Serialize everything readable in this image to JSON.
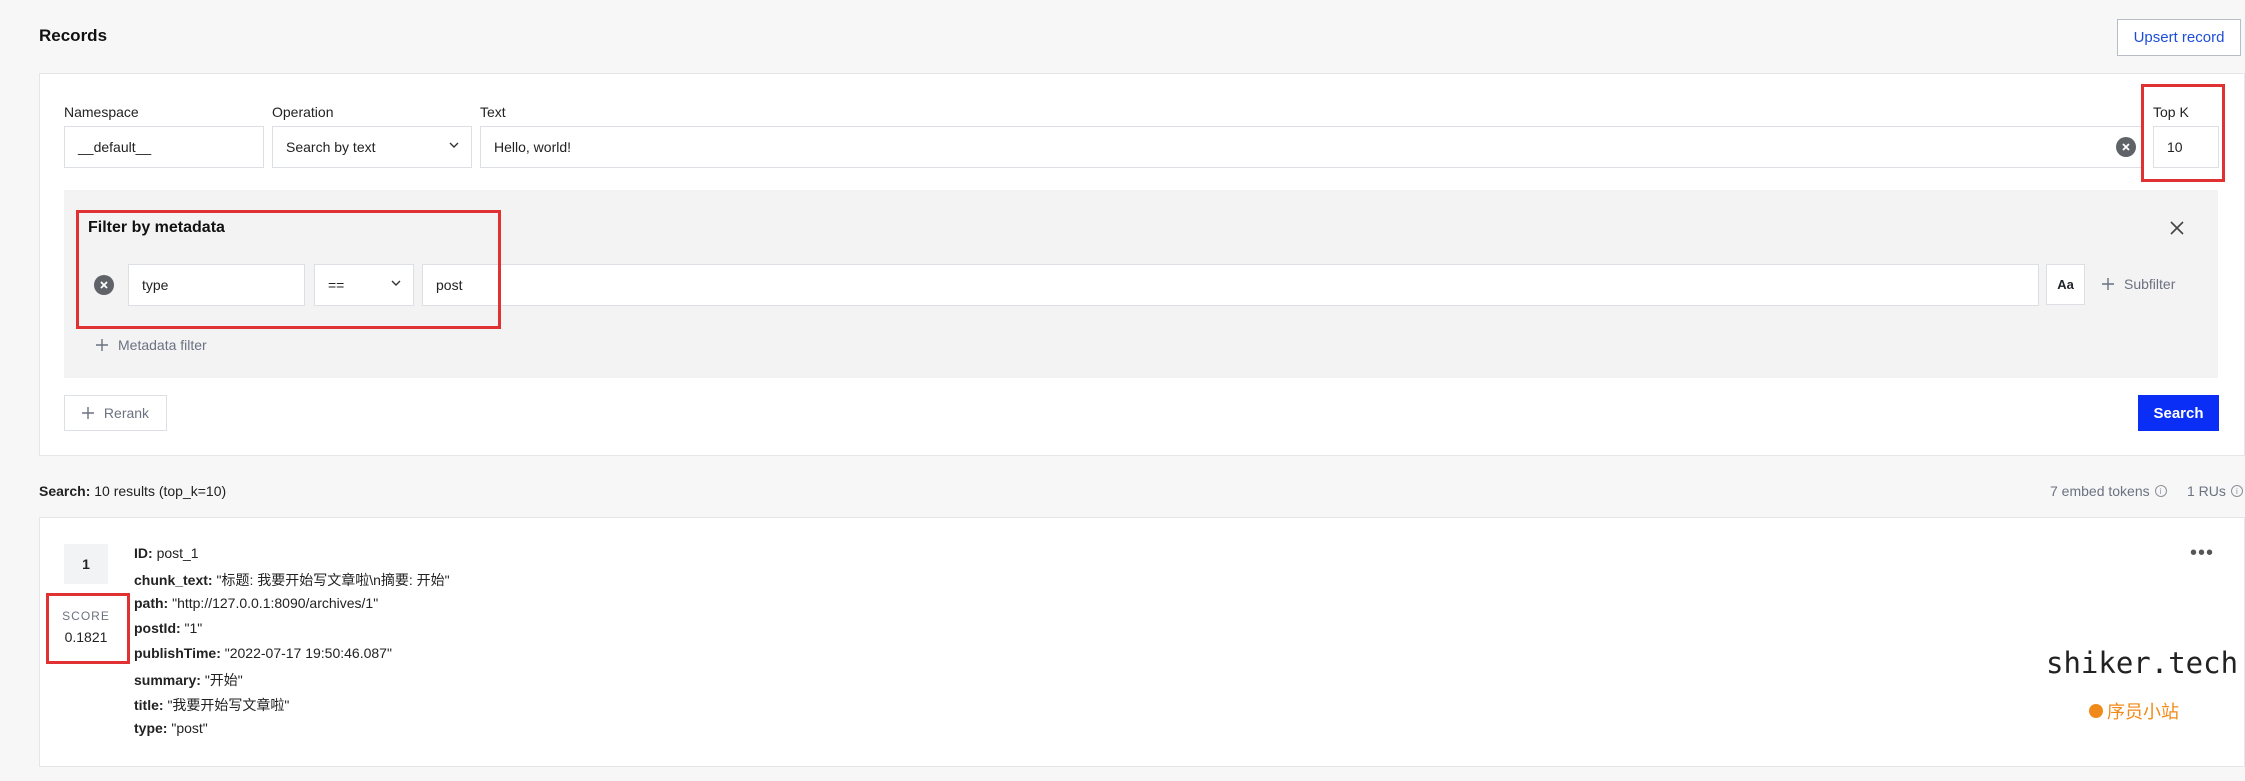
{
  "header": {
    "title": "Records",
    "upsert_label": "Upsert record"
  },
  "query": {
    "namespace_label": "Namespace",
    "namespace_value": "__default__",
    "operation_label": "Operation",
    "operation_value": "Search by text",
    "text_label": "Text",
    "text_value": "Hello, world!",
    "topk_label": "Top K",
    "topk_value": "10"
  },
  "filter": {
    "title": "Filter by metadata",
    "field_value": "type",
    "operator_value": "==",
    "value_value": "post",
    "aa_label": "Aa",
    "subfilter_label": "Subfilter",
    "add_filter_label": "Metadata filter"
  },
  "actions": {
    "rerank_label": "Rerank",
    "search_label": "Search"
  },
  "summary": {
    "prefix": "Search:",
    "text": "10 results (top_k=10)",
    "embed_tokens": "7 embed tokens",
    "rus": "1 RUs"
  },
  "result": {
    "rank": "1",
    "score_label": "SCORE",
    "score_value": "0.1821",
    "fields": [
      {
        "key": "ID:",
        "value": "post_1"
      },
      {
        "key": "chunk_text:",
        "value": "\"标题: 我要开始写文章啦\\n摘要: 开始\""
      },
      {
        "key": "path:",
        "value": "\"http://127.0.0.1:8090/archives/1\""
      },
      {
        "key": "postId:",
        "value": "\"1\""
      },
      {
        "key": "publishTime:",
        "value": "\"2022-07-17 19:50:46.087\""
      },
      {
        "key": "summary:",
        "value": "\"开始\""
      },
      {
        "key": "title:",
        "value": "\"我要开始写文章啦\""
      },
      {
        "key": "type:",
        "value": "\"post\""
      }
    ]
  },
  "watermark": {
    "line1": "shiker.tech",
    "line2": "序员小站"
  },
  "colors": {
    "accent": "#0a2ef5",
    "highlight": "#e03232",
    "link": "#1d4ed8"
  }
}
